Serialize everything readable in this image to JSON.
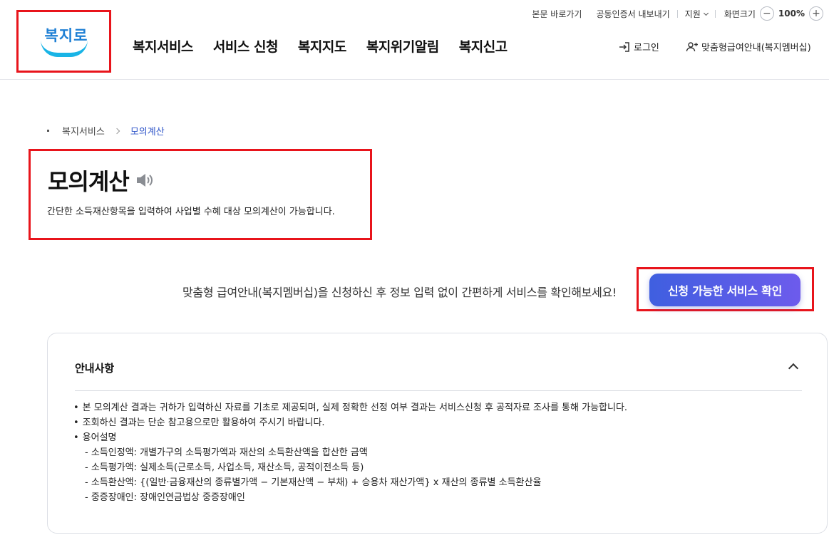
{
  "header": {
    "logo_text": "복지로",
    "util": {
      "skip_link": "본문 바로가기",
      "cert_export": "공동인증서 내보내기",
      "support": "지원",
      "zoom_label": "화면크기",
      "zoom_minus": "−",
      "zoom_value": "100%",
      "zoom_plus": "+"
    },
    "gnb": [
      "복지서비스",
      "서비스 신청",
      "복지지도",
      "복지위기알림",
      "복지신고"
    ],
    "login": "로그인",
    "membership": "맞춤형급여안내(복지멤버십)"
  },
  "breadcrumb": {
    "parent": "복지서비스",
    "current": "모의계산"
  },
  "page": {
    "title": "모의계산",
    "description": "간단한 소득재산항목을 입력하여 사업별 수혜 대상 모의계산이 가능합니다."
  },
  "promo": {
    "text": "맞춤형 급여안내(복지멤버십)을 신청하신 후 정보 입력 없이 간편하게 서비스를 확인해보세요!",
    "button": "신청 가능한 서비스 확인"
  },
  "notice": {
    "title": "안내사항",
    "items": [
      "본 모의계산 결과는 귀하가 입력하신 자료를 기초로 제공되며, 실제 정확한 선정 여부 결과는 서비스신청 후 공적자료 조사를 통해 가능합니다.",
      "조회하신 결과는 단순 참고용으로만 활용하여 주시기 바랍니다.",
      "용어설명"
    ],
    "terms": [
      "소득인정액: 개별가구의 소득평가액과 재산의 소득환산액을 합산한 금액",
      "소득평가액: 실제소득(근로소득, 사업소득, 재산소득, 공적이전소득 등)",
      "소득환산액: {(일반·금융재산의 종류별가액 − 기본재산액 − 부채) + 승용차 재산가액} x 재산의 종류별 소득환산율",
      "중증장애인: 장애인연금법상 중증장애인"
    ]
  },
  "colors": {
    "brand_blue": "#1e7fd4",
    "accent": "#2f55c9",
    "cta_start": "#3f5fe0",
    "cta_end": "#6d5bec",
    "highlight_border": "#e8141b"
  }
}
